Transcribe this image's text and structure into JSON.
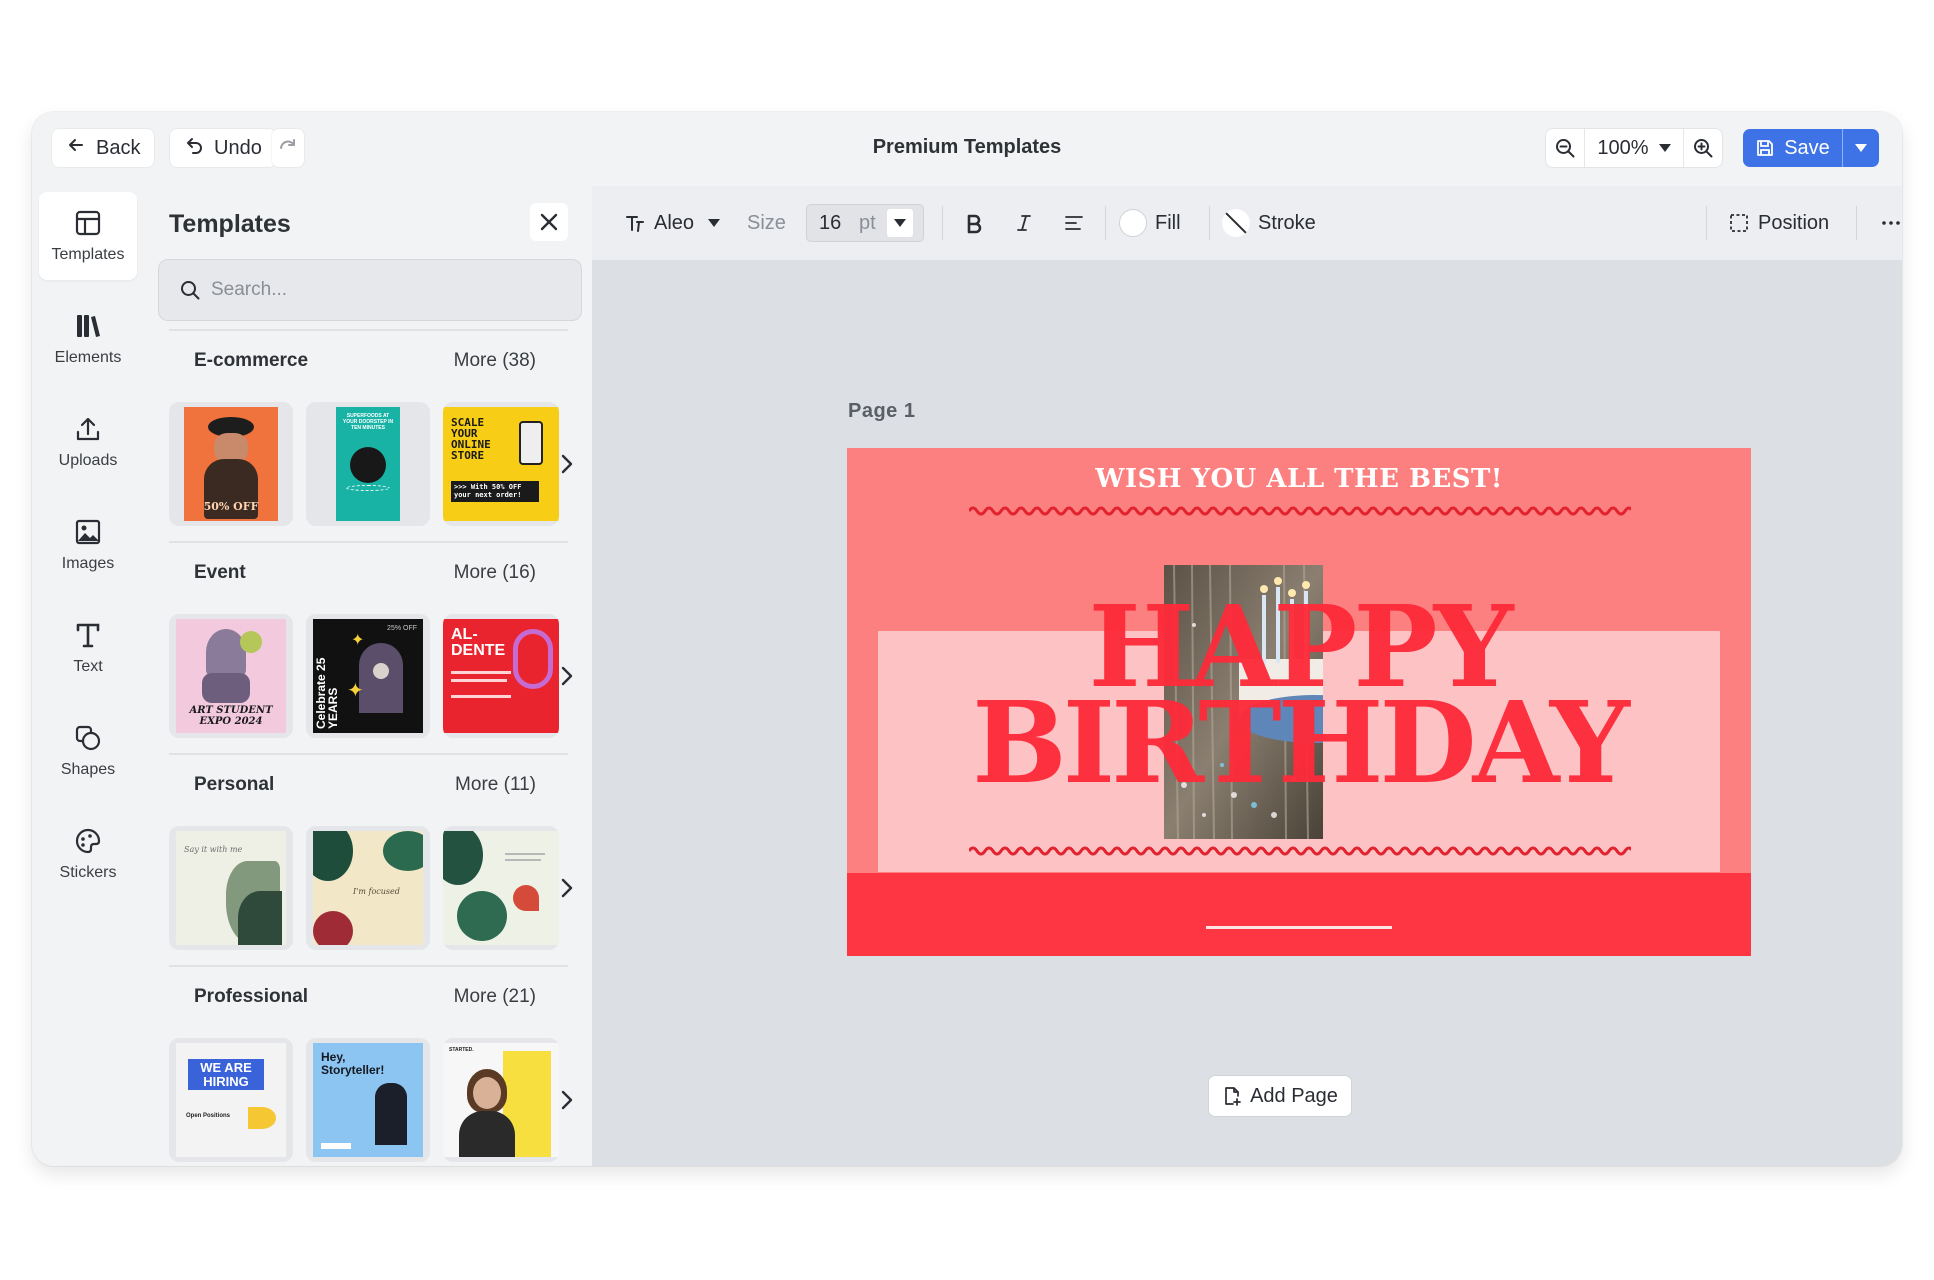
{
  "header": {
    "back_label": "Back",
    "undo_label": "Undo",
    "title": "Premium Templates",
    "zoom_value": "100%",
    "save_label": "Save"
  },
  "rail": {
    "items": [
      {
        "label": "Templates",
        "icon": "layout-icon",
        "active": true
      },
      {
        "label": "Elements",
        "icon": "library-icon"
      },
      {
        "label": "Uploads",
        "icon": "upload-icon"
      },
      {
        "label": "Images",
        "icon": "image-icon"
      },
      {
        "label": "Text",
        "icon": "text-icon"
      },
      {
        "label": "Shapes",
        "icon": "shapes-icon"
      },
      {
        "label": "Stickers",
        "icon": "sticker-icon"
      }
    ]
  },
  "panel": {
    "title": "Templates",
    "search_placeholder": "Search...",
    "categories": [
      {
        "name": "E-commerce",
        "more": "More (38)",
        "thumbs": [
          {
            "text": "50% OFF",
            "bg": "#f0723c"
          },
          {
            "text": "SUPERFOODS AT YOUR DOORSTEP IN TEN MINUTES",
            "bg": "#19b3a5"
          },
          {
            "text": "SCALE YOUR ONLINE STORE",
            "sub": ">>> With 50% OFF your next order!",
            "bg": "#f8cd15"
          }
        ]
      },
      {
        "name": "Event",
        "more": "More (16)",
        "thumbs": [
          {
            "text": "ART STUDENT EXPO 2024",
            "bg": "#f2c9dd"
          },
          {
            "text": "Celebrate 25 YEARS",
            "sub": "25% OFF",
            "bg": "#111111"
          },
          {
            "text": "AL-DENTE",
            "bg": "#e9242e"
          }
        ]
      },
      {
        "name": "Personal",
        "more": "More (11)",
        "thumbs": [
          {
            "text": "Say it with me",
            "bg": "#eef0e6"
          },
          {
            "text": "I'm focused",
            "bg": "#f2e8c7"
          },
          {
            "text": "",
            "bg": "#eef2e6"
          }
        ]
      },
      {
        "name": "Professional",
        "more": "More (21)",
        "thumbs": [
          {
            "text": "WE ARE HIRING",
            "sub": "Open Positions",
            "bg": "#f3f3f3"
          },
          {
            "text": "Hey, Storyteller!",
            "bg": "#8cc4f2"
          },
          {
            "text": "STARTED.",
            "bg": "#f7df3f"
          }
        ]
      }
    ]
  },
  "toolbar": {
    "font_name": "Aleo",
    "size_label": "Size",
    "size_value": "16",
    "size_unit": "pt",
    "fill_label": "Fill",
    "stroke_label": "Stroke",
    "position_label": "Position"
  },
  "canvas": {
    "page_label": "Page  1",
    "card": {
      "top_text": "WISH YOU ALL THE BEST!",
      "line1": "HAPPY",
      "line2": "BIRTHDAY",
      "bg": "#fd8080",
      "inner_bg": "#fdc2c4",
      "accent": "#fe2b3a"
    },
    "add_page_label": "Add Page"
  },
  "colors": {
    "accent_blue": "#3d73e6",
    "app_bg": "#f2f3f5",
    "editor_bg": "#dcdfe3"
  }
}
